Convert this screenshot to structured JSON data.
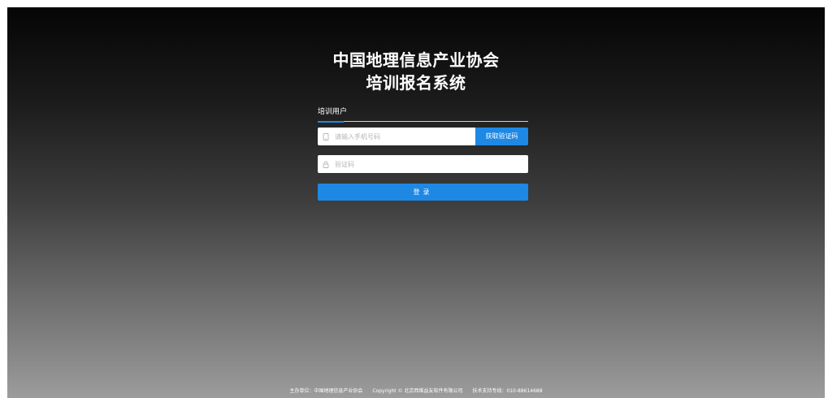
{
  "header": {
    "title_line1": "中国地理信息产业协会",
    "title_line2": "培训报名系统"
  },
  "tabs": [
    {
      "label": "培训用户",
      "active": true
    }
  ],
  "form": {
    "phone_placeholder": "请输入手机号码",
    "get_code_label": "获取验证码",
    "code_placeholder": "验证码",
    "login_label": "登录"
  },
  "footer": {
    "organizer": "主办单位：中国地理信息产业协会",
    "copyright": "Copyright © 北京西维益友软件有限公司",
    "support": "技术支持专线：010-88614688"
  },
  "colors": {
    "accent": "#1e88e5",
    "text_on_dark": "#ffffff"
  },
  "icons": {
    "phone": "phone-icon",
    "lock": "lock-icon"
  }
}
